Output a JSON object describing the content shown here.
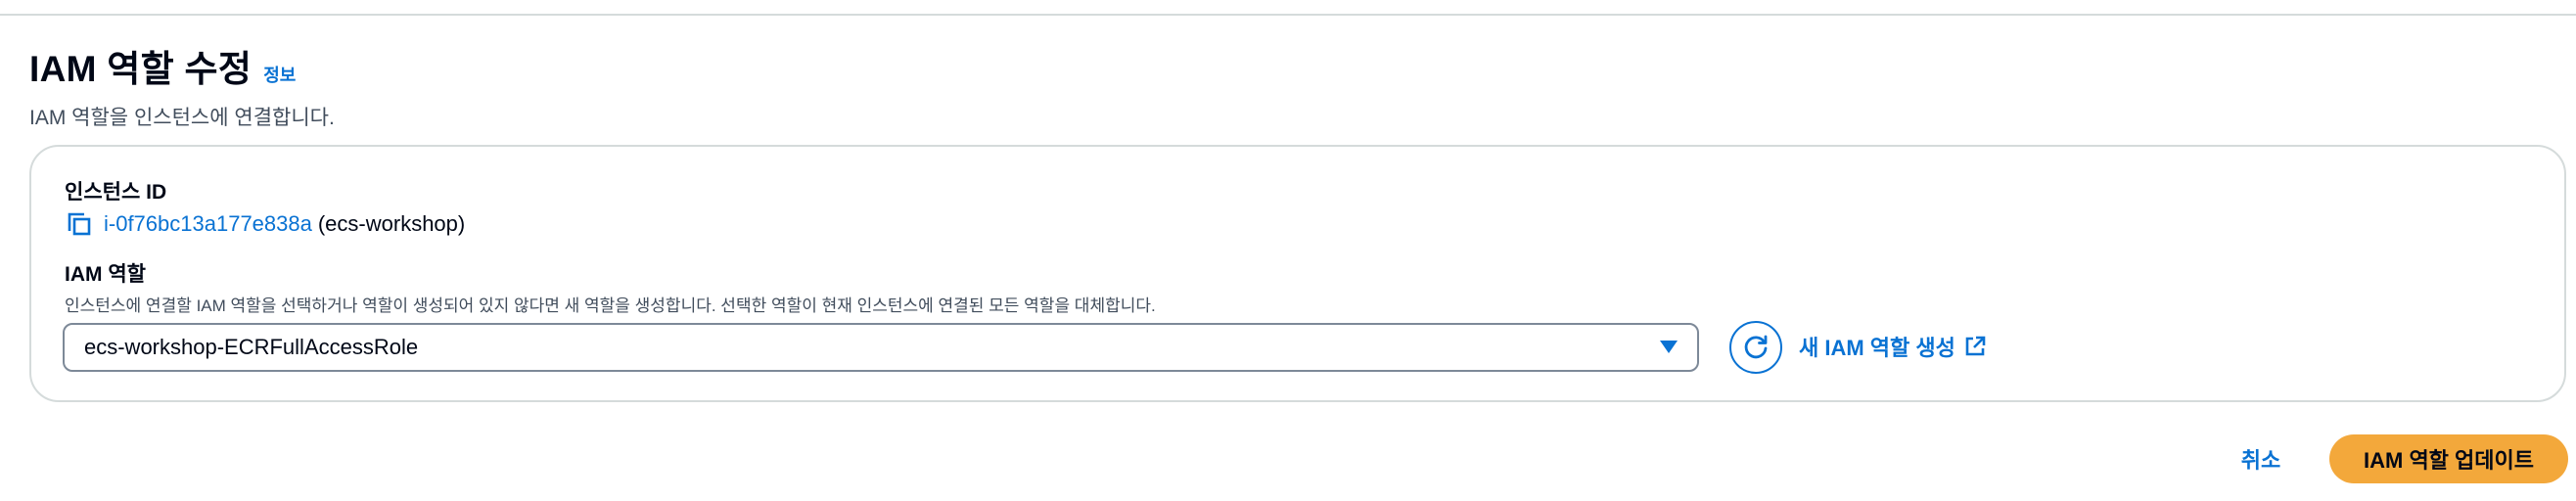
{
  "header": {
    "title": "IAM 역할 수정",
    "info_link": "정보",
    "description": "IAM 역할을 인스턴스에 연결합니다."
  },
  "form": {
    "instance": {
      "label": "인스턴스 ID",
      "id": "i-0f76bc13a177e838a",
      "name": "(ecs-workshop)",
      "copy_icon": "copy-icon"
    },
    "iam_role": {
      "label": "IAM 역할",
      "description": "인스턴스에 연결할 IAM 역할을 선택하거나 역할이 생성되어 있지 않다면 새 역할을 생성합니다. 선택한 역할이 현재 인스턴스에 연결된 모든 역할을 대체합니다.",
      "selected": "ecs-workshop-ECRFullAccessRole",
      "refresh_icon": "refresh-icon",
      "create_link": "새 IAM 역할 생성",
      "external_icon": "external-link-icon"
    }
  },
  "actions": {
    "cancel": "취소",
    "submit": "IAM 역할 업데이트"
  },
  "colors": {
    "link": "#0972d3",
    "primary": "#f3a83b",
    "text": "#000716",
    "muted": "#414d5c",
    "border": "#d5dbdb"
  }
}
